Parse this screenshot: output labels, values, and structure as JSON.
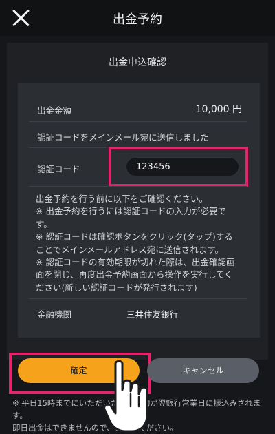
{
  "header": {
    "title": "出金予約"
  },
  "panel": {
    "title": "出金申込確認"
  },
  "details": {
    "amount_label": "出金金額",
    "amount_value": "10,000 円",
    "sent_message": "認証コードをメインメール宛に送信しました",
    "code_label": "認証コード",
    "code_value": "123456",
    "notes": [
      "出金予約を行う前に以下をご確認ください。",
      "※ 出金予約を行うには認証コードの入力が必要です。",
      "※ 認証コードは確認ボタンをクリック(タップ)することでメインメールアドレス宛に送信されます。",
      "※ 認証コードの有効期限が切れた際は、出金確認画面を閉じ、再度出金予約画面から操作を実行してください(新しい認証コードが発行されます)"
    ],
    "bank_label": "金融機関",
    "bank_value": "三井住友銀行"
  },
  "buttons": {
    "confirm_label": "確定",
    "cancel_label": "キャンセル"
  },
  "footnote": {
    "line1": "※ 平日15時までにいただいた出金予約が翌銀行営業日に振込みされます。",
    "line2": "即日出金はできませんので、ご了承ください。"
  },
  "colors": {
    "accent": "#f7a21b",
    "highlight": "#e5236a",
    "cancel": "#5a5e66"
  }
}
